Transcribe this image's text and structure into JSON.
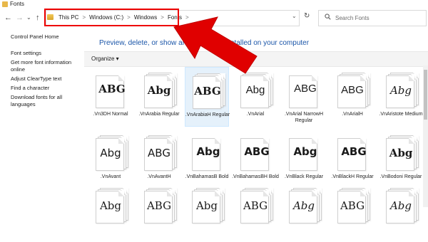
{
  "window": {
    "title": "Fonts"
  },
  "nav": {
    "back": "←",
    "forward": "→",
    "history": "⌄",
    "up": "↑",
    "breadcrumbs": [
      "This PC",
      "Windows (C:)",
      "Windows",
      "Fonts"
    ],
    "separator": ">",
    "dropdown": "⌄",
    "refresh": "↻"
  },
  "search": {
    "placeholder": "Search Fonts",
    "icon": "search-icon"
  },
  "sidebar": {
    "items": [
      "Control Panel Home",
      "Font settings",
      "Get more font information online",
      "Adjust ClearType text",
      "Find a character",
      "Download fonts for all languages"
    ]
  },
  "main": {
    "heading": "Preview, delete, or show and hide fonts installed on your computer",
    "toolbar": {
      "organize": "Organize ▾"
    }
  },
  "fonts": [
    {
      "name": ".Vn3DH Normal",
      "sample": "ABG",
      "weight": "bold",
      "style": "normal",
      "family": "DejaVu Serif",
      "stacked": false
    },
    {
      "name": ".VnArabia Regular",
      "sample": "Abg",
      "weight": "bold",
      "style": "normal",
      "family": "DejaVu Serif",
      "stacked": true
    },
    {
      "name": ".VnArabiaH Regular",
      "sample": "ABG",
      "weight": "bold",
      "style": "normal",
      "family": "DejaVu Serif",
      "stacked": true,
      "selected": true
    },
    {
      "name": ".VnArial",
      "sample": "Abg",
      "weight": "normal",
      "style": "normal",
      "family": "Liberation Sans",
      "stacked": true
    },
    {
      "name": ".VnArial NarrowH Regular",
      "sample": "ABG",
      "weight": "normal",
      "style": "normal",
      "family": "Liberation Sans",
      "stacked": false
    },
    {
      "name": ".VnArialH",
      "sample": "ABG",
      "weight": "normal",
      "style": "normal",
      "family": "Liberation Sans",
      "stacked": true
    },
    {
      "name": ".VnAristote Medium",
      "sample": "Abg",
      "weight": "normal",
      "style": "italic",
      "family": "DejaVu Serif",
      "stacked": true
    },
    {
      "name": ".VnAvant",
      "sample": "Abg",
      "weight": "normal",
      "style": "normal",
      "family": "DejaVu Sans",
      "stacked": true
    },
    {
      "name": ".VnAvantH",
      "sample": "ABG",
      "weight": "normal",
      "style": "normal",
      "family": "DejaVu Sans",
      "stacked": true
    },
    {
      "name": ".VnBahamasB Bold",
      "sample": "Abg",
      "weight": "bold",
      "style": "normal",
      "family": "DejaVu Sans",
      "stacked": false
    },
    {
      "name": ".VnBahamasBH Bold",
      "sample": "ABG",
      "weight": "bold",
      "style": "normal",
      "family": "DejaVu Sans",
      "stacked": false
    },
    {
      "name": ".VnBlack Regular",
      "sample": "Abg",
      "weight": "bold",
      "style": "normal",
      "family": "DejaVu Sans",
      "stacked": false
    },
    {
      "name": ".VnBlackH Regular",
      "sample": "ABG",
      "weight": "bold",
      "style": "normal",
      "family": "DejaVu Sans",
      "stacked": false
    },
    {
      "name": ".VnBodoni Regular",
      "sample": "Abg",
      "weight": "bold",
      "style": "normal",
      "family": "DejaVu Serif",
      "stacked": true
    },
    {
      "name": "",
      "sample": "Abg",
      "weight": "normal",
      "style": "normal",
      "family": "DejaVu Serif",
      "stacked": true
    },
    {
      "name": "",
      "sample": "ABG",
      "weight": "normal",
      "style": "normal",
      "family": "DejaVu Serif",
      "stacked": true
    },
    {
      "name": "",
      "sample": "Abg",
      "weight": "normal",
      "style": "normal",
      "family": "DejaVu Serif",
      "stacked": true
    },
    {
      "name": "",
      "sample": "ABG",
      "weight": "normal",
      "style": "normal",
      "family": "DejaVu Serif",
      "stacked": true
    },
    {
      "name": "",
      "sample": "Abg",
      "weight": "normal",
      "style": "italic",
      "family": "DejaVu Serif",
      "stacked": true
    },
    {
      "name": "",
      "sample": "ABG",
      "weight": "normal",
      "style": "normal",
      "family": "DejaVu Serif",
      "stacked": true
    },
    {
      "name": "",
      "sample": "Abg",
      "weight": "normal",
      "style": "italic",
      "family": "DejaVu Serif",
      "stacked": true
    }
  ],
  "annotation": {
    "color": "#e00000",
    "arrow": "red-arrow"
  }
}
